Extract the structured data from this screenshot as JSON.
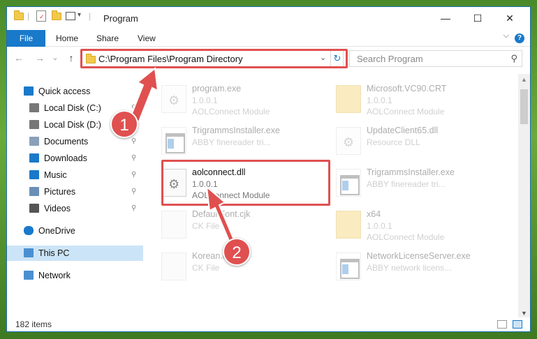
{
  "window": {
    "title": "Program",
    "min_glyph": "—",
    "max_glyph": "☐",
    "close_glyph": "✕"
  },
  "ribbon": {
    "tabs": [
      "File",
      "Home",
      "Share",
      "View"
    ],
    "help_glyph": "?",
    "collapse_glyph": "⌵"
  },
  "nav": {
    "back_glyph": "←",
    "forward_glyph": "→",
    "recent_glyph": "⌄",
    "up_glyph": "↑",
    "address": "C:\\Program Files\\Program Directory",
    "refresh_glyph": "↻",
    "search_placeholder": "Search Program",
    "search_glyph": "⚲"
  },
  "sidebar": {
    "items": [
      {
        "label": "Quick access",
        "icon": "star-icon",
        "pinned": false
      },
      {
        "label": "Local Disk (C:)",
        "icon": "drive-icon",
        "pinned": true
      },
      {
        "label": "Local Disk (D:)",
        "icon": "drive-icon",
        "pinned": true
      },
      {
        "label": "Documents",
        "icon": "documents-icon",
        "pinned": true
      },
      {
        "label": "Downloads",
        "icon": "download-icon",
        "pinned": true
      },
      {
        "label": "Music",
        "icon": "music-icon",
        "pinned": true
      },
      {
        "label": "Pictures",
        "icon": "pictures-icon",
        "pinned": true
      },
      {
        "label": "Videos",
        "icon": "videos-icon",
        "pinned": true
      },
      {
        "label": "OneDrive",
        "icon": "cloud-icon",
        "pinned": false
      },
      {
        "label": "This PC",
        "icon": "computer-icon",
        "pinned": false,
        "selected": true
      },
      {
        "label": "Network",
        "icon": "network-icon",
        "pinned": false
      }
    ],
    "pin_glyph": "📌"
  },
  "files": [
    {
      "name": "program.exe",
      "line1": "1.0.0.1",
      "line2": "AOLConnect Module",
      "icon": "exe-icon"
    },
    {
      "name": "Microsoft.VC90.CRT",
      "line1": "1.0.0.1",
      "line2": "AOLConnect Module",
      "icon": "folder-icon"
    },
    {
      "name": "TrigrammsInstaller.exe",
      "line1": "ABBY finereader tri...",
      "line2": "",
      "icon": "app-icon"
    },
    {
      "name": "UpdateClient65.dll",
      "line1": "Resource DLL",
      "line2": "",
      "icon": "dll-icon"
    },
    {
      "name": "aolconnect.dll",
      "line1": "1.0.0.1",
      "line2": "AOLConnect Module",
      "icon": "dll-icon",
      "highlighted": true
    },
    {
      "name": "TrigrammsInstaller.exe",
      "line1": "ABBY finereader tri...",
      "line2": "",
      "icon": "app-icon"
    },
    {
      "name": "DefaultFont.cjk",
      "line1": "CK File",
      "line2": "",
      "icon": "file-icon"
    },
    {
      "name": "x64",
      "line1": "1.0.0.1",
      "line2": "AOLConnect Module",
      "icon": "folder-icon"
    },
    {
      "name": "Korean.cjk",
      "line1": "CK File",
      "line2": "",
      "icon": "file-icon"
    },
    {
      "name": "NetworkLicenseServer.exe",
      "line1": "ABBY network licens...",
      "line2": "",
      "icon": "app-icon"
    }
  ],
  "status": {
    "count": "182 items"
  },
  "callouts": [
    "1",
    "2"
  ],
  "colors": {
    "accent": "#1979ca",
    "highlight": "#e05050",
    "selected_bg": "#cce4f7"
  }
}
